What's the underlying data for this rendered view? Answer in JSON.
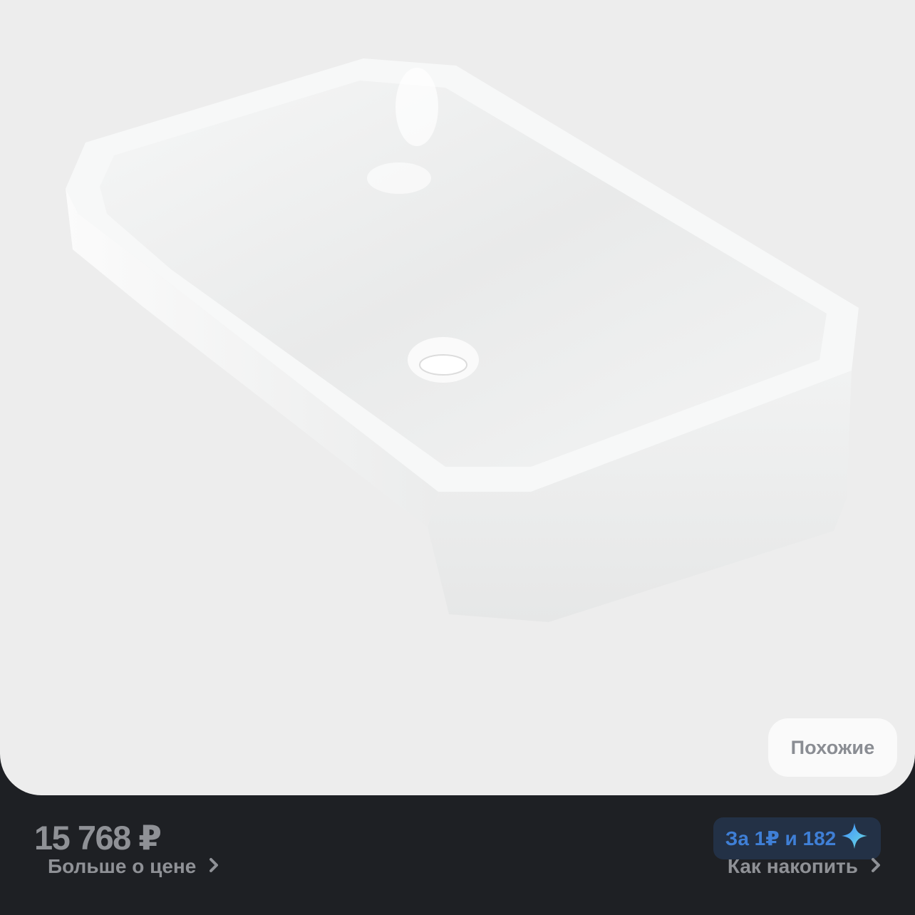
{
  "product": {
    "image_alt": "white-ceramic-sink"
  },
  "similar_button": {
    "label": "Похожие"
  },
  "price": {
    "value": "15 768 ₽",
    "more_label": "Больше о цене"
  },
  "bonus": {
    "label": "За 1₽ и 182",
    "icon": "sparkle-star-icon",
    "how_label": "Как накопить"
  },
  "colors": {
    "image_bg": "#ededed",
    "bar_bg": "#1e2024",
    "pill_bg": "#233146",
    "pill_text": "#3f7fd6",
    "muted_text": "#8f9196"
  }
}
